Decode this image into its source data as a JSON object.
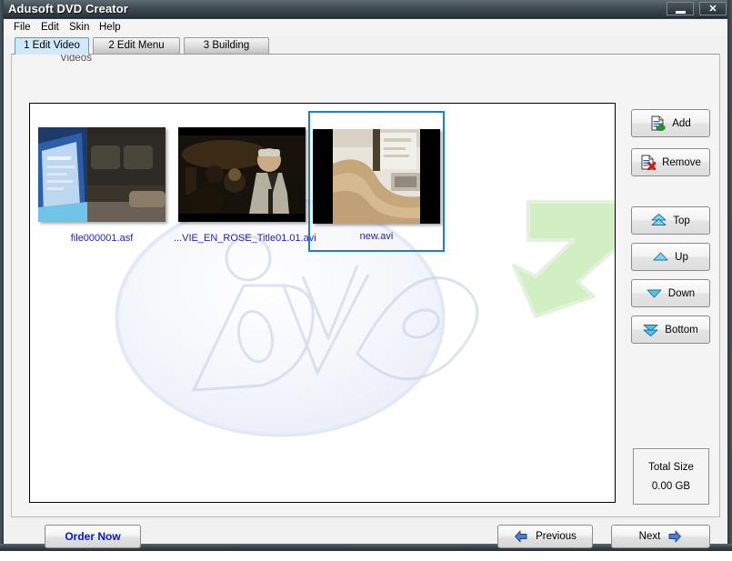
{
  "window": {
    "title": "Adusoft DVD Creator",
    "minimize_label": "minimize",
    "close_label": "✕"
  },
  "menu": {
    "items": [
      {
        "label": "File"
      },
      {
        "label": "Edit"
      },
      {
        "label": "Skin"
      },
      {
        "label": "Help"
      }
    ]
  },
  "tabs": [
    {
      "label": "1 Edit Video",
      "active": true
    },
    {
      "label": "2 Edit Menu",
      "active": false
    },
    {
      "label": "3 Building",
      "active": false
    }
  ],
  "content": {
    "videos_label": "Videos",
    "videos": [
      {
        "filename": "file000001.asf",
        "selected": false,
        "thumb": "laptop-couch"
      },
      {
        "filename": "...VIE_EN_ROSE_Title01.01.avi",
        "selected": false,
        "thumb": "movie-scene"
      },
      {
        "filename": "new.avi",
        "selected": true,
        "thumb": "desk-keyboard"
      }
    ]
  },
  "side_buttons": [
    {
      "label": "Add",
      "icon": "document-add-icon"
    },
    {
      "label": "Remove",
      "icon": "document-remove-icon"
    },
    {
      "label": "Top",
      "icon": "double-arrow-up-icon"
    },
    {
      "label": "Up",
      "icon": "arrow-up-icon"
    },
    {
      "label": "Down",
      "icon": "arrow-down-icon"
    },
    {
      "label": "Bottom",
      "icon": "double-arrow-down-icon"
    }
  ],
  "total_size": {
    "title": "Total Size",
    "value": "0.00 GB"
  },
  "bottom_bar": {
    "order_label": "Order Now",
    "previous_label": "Previous",
    "next_label": "Next"
  },
  "colors": {
    "selection_blue": "#1a7fd4",
    "link_blue": "#1f1fb4",
    "order_blue": "#0a18c8",
    "active_tab": "#cfe9fa",
    "titlebar_dark": "#2c353b",
    "accent_green": "#c9edb8"
  }
}
